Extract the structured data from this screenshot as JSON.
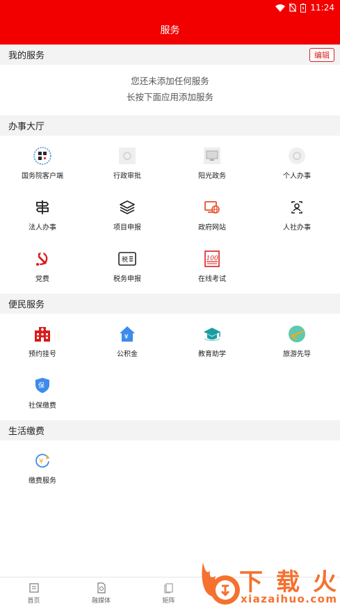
{
  "status": {
    "time": "11:24"
  },
  "header": {
    "title": "服务"
  },
  "my_services": {
    "title": "我的服务",
    "edit_label": "编辑",
    "empty_line1": "您还未添加任何服务",
    "empty_line2": "长按下面应用添加服务"
  },
  "hall": {
    "title": "办事大厅",
    "items": [
      {
        "label": "国务院客户端",
        "icon": "qr-code-icon"
      },
      {
        "label": "行政审批",
        "icon": "placeholder-icon"
      },
      {
        "label": "阳光政务",
        "icon": "monitor-icon"
      },
      {
        "label": "个人办事",
        "icon": "placeholder-icon"
      },
      {
        "label": "法人办事",
        "icon": "signpost-icon"
      },
      {
        "label": "项目申报",
        "icon": "layers-icon"
      },
      {
        "label": "政府网站",
        "icon": "web-icon"
      },
      {
        "label": "人社办事",
        "icon": "person-card-icon"
      },
      {
        "label": "党费",
        "icon": "party-emblem-icon"
      },
      {
        "label": "税务申报",
        "icon": "tax-icon"
      },
      {
        "label": "在线考试",
        "icon": "exam-icon"
      }
    ]
  },
  "convenience": {
    "title": "便民服务",
    "items": [
      {
        "label": "预约挂号",
        "icon": "hospital-icon"
      },
      {
        "label": "公积金",
        "icon": "housing-fund-icon"
      },
      {
        "label": "教育助学",
        "icon": "graduation-cap-icon"
      },
      {
        "label": "旅游先导",
        "icon": "airplane-icon"
      },
      {
        "label": "社保缴费",
        "icon": "social-security-shield-icon"
      }
    ]
  },
  "living": {
    "title": "生活缴费",
    "items": [
      {
        "label": "缴费服务",
        "icon": "payment-icon"
      }
    ]
  },
  "tabs": [
    {
      "label": "首页",
      "icon": "home-icon"
    },
    {
      "label": "融媒体",
      "icon": "media-icon"
    },
    {
      "label": "矩阵",
      "icon": "matrix-icon"
    }
  ],
  "watermark": {
    "logo_text": "下载火",
    "site": "xiazaihuo.com"
  },
  "colors": {
    "brand_red": "#f20000",
    "accent_red": "#d81e1e",
    "section_bg": "#f3f3f3"
  }
}
